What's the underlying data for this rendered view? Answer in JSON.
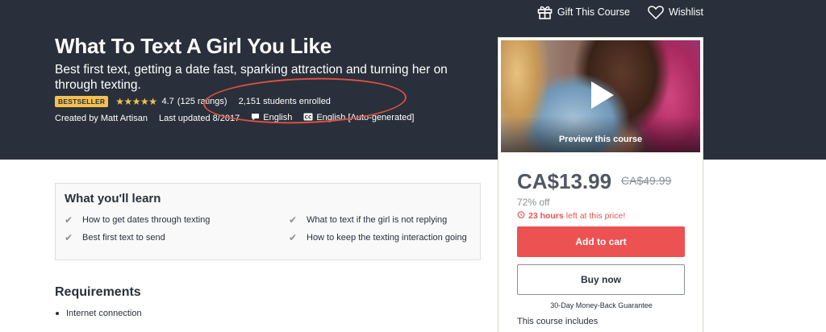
{
  "top_actions": {
    "gift_label": "Gift This Course",
    "wishlist_label": "Wishlist"
  },
  "course": {
    "title": "What To Text A Girl You Like",
    "subtitle": "Best first text, getting a date fast, sparking attraction and turning her on through texting.",
    "badge": "BESTSELLER",
    "rating_stars": 4.7,
    "rating": "4.7",
    "ratings_count": "(125 ratings)",
    "enrolled": "2,151 students enrolled",
    "created_by": "Created by Matt Artisan",
    "last_updated": "Last updated 8/2017",
    "language": "English",
    "captions": "English [Auto-generated]"
  },
  "sidebar": {
    "preview_label": "Preview this course",
    "price": "CA$13.99",
    "original_price": "CA$49.99",
    "discount": "72% off",
    "countdown_bold": "23 hours",
    "countdown_rest": "left at this price!",
    "add_to_cart": "Add to cart",
    "buy_now": "Buy now",
    "guarantee": "30-Day Money-Back Guarantee",
    "includes": "This course includes"
  },
  "learn": {
    "title": "What you'll learn",
    "items": [
      "How to get dates through texting",
      "What to text if the girl is not replying",
      "Best first text to send",
      "How to keep the texting interaction going"
    ]
  },
  "requirements": {
    "title": "Requirements",
    "items": [
      "Internet connection"
    ]
  },
  "colors": {
    "hero_bg": "#29303b",
    "accent_red": "#ec5252",
    "star_gold": "#f4c150",
    "annotation": "#e24f3f"
  }
}
